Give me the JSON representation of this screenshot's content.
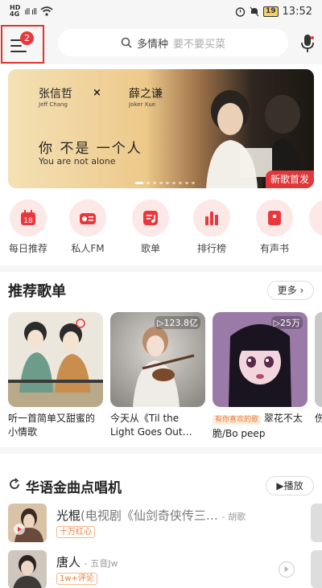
{
  "status_bar": {
    "net_label": "HD",
    "net_type": "4G",
    "signal": "ıll ıll",
    "battery": "19",
    "time": "13:52"
  },
  "header": {
    "menu_badge": "2",
    "search_keyword": "多情种",
    "search_placeholder": "要不要买菜"
  },
  "banner": {
    "artist1": "张信哲",
    "artist1_en": "Jeff Chang",
    "cross": "×",
    "artist2": "薛之谦",
    "artist2_en": "Joker Xue",
    "title": "你  不是   一个人",
    "title_en": "You are not alone",
    "tag": "新歌首发"
  },
  "quick_entries": [
    {
      "label": "每日推荐",
      "day": "18"
    },
    {
      "label": "私人FM"
    },
    {
      "label": "歌单"
    },
    {
      "label": "排行榜"
    },
    {
      "label": "有声书"
    }
  ],
  "recommend": {
    "title": "推荐歌单",
    "more": "更多",
    "more_arrow": "›",
    "playlists": [
      {
        "count": "",
        "text": "听一首简单又甜蜜的小情歌"
      },
      {
        "count": "▷123.8亿",
        "text": "今天从《Til the Light Goes Out…"
      },
      {
        "count": "▷25万",
        "tag": "有你喜欢的歌",
        "text": "翠花不太脆/Bo peep"
      },
      {
        "text": "伤"
      }
    ]
  },
  "golden": {
    "title": "华语金曲点唱机",
    "play": "▶播放",
    "songs": [
      {
        "name": "光棍",
        "detail": "(电视剧《仙剑奇侠传三…",
        "artist": "- 胡歌",
        "badge": "十万红心"
      },
      {
        "name": "唐人",
        "detail": "",
        "artist": "- 五音Jw",
        "badge": "1w+评论"
      }
    ]
  },
  "colors": {
    "accent": "#e8383d",
    "highlight_box": "#e0332f",
    "icon_bg": "#fde8e8"
  }
}
